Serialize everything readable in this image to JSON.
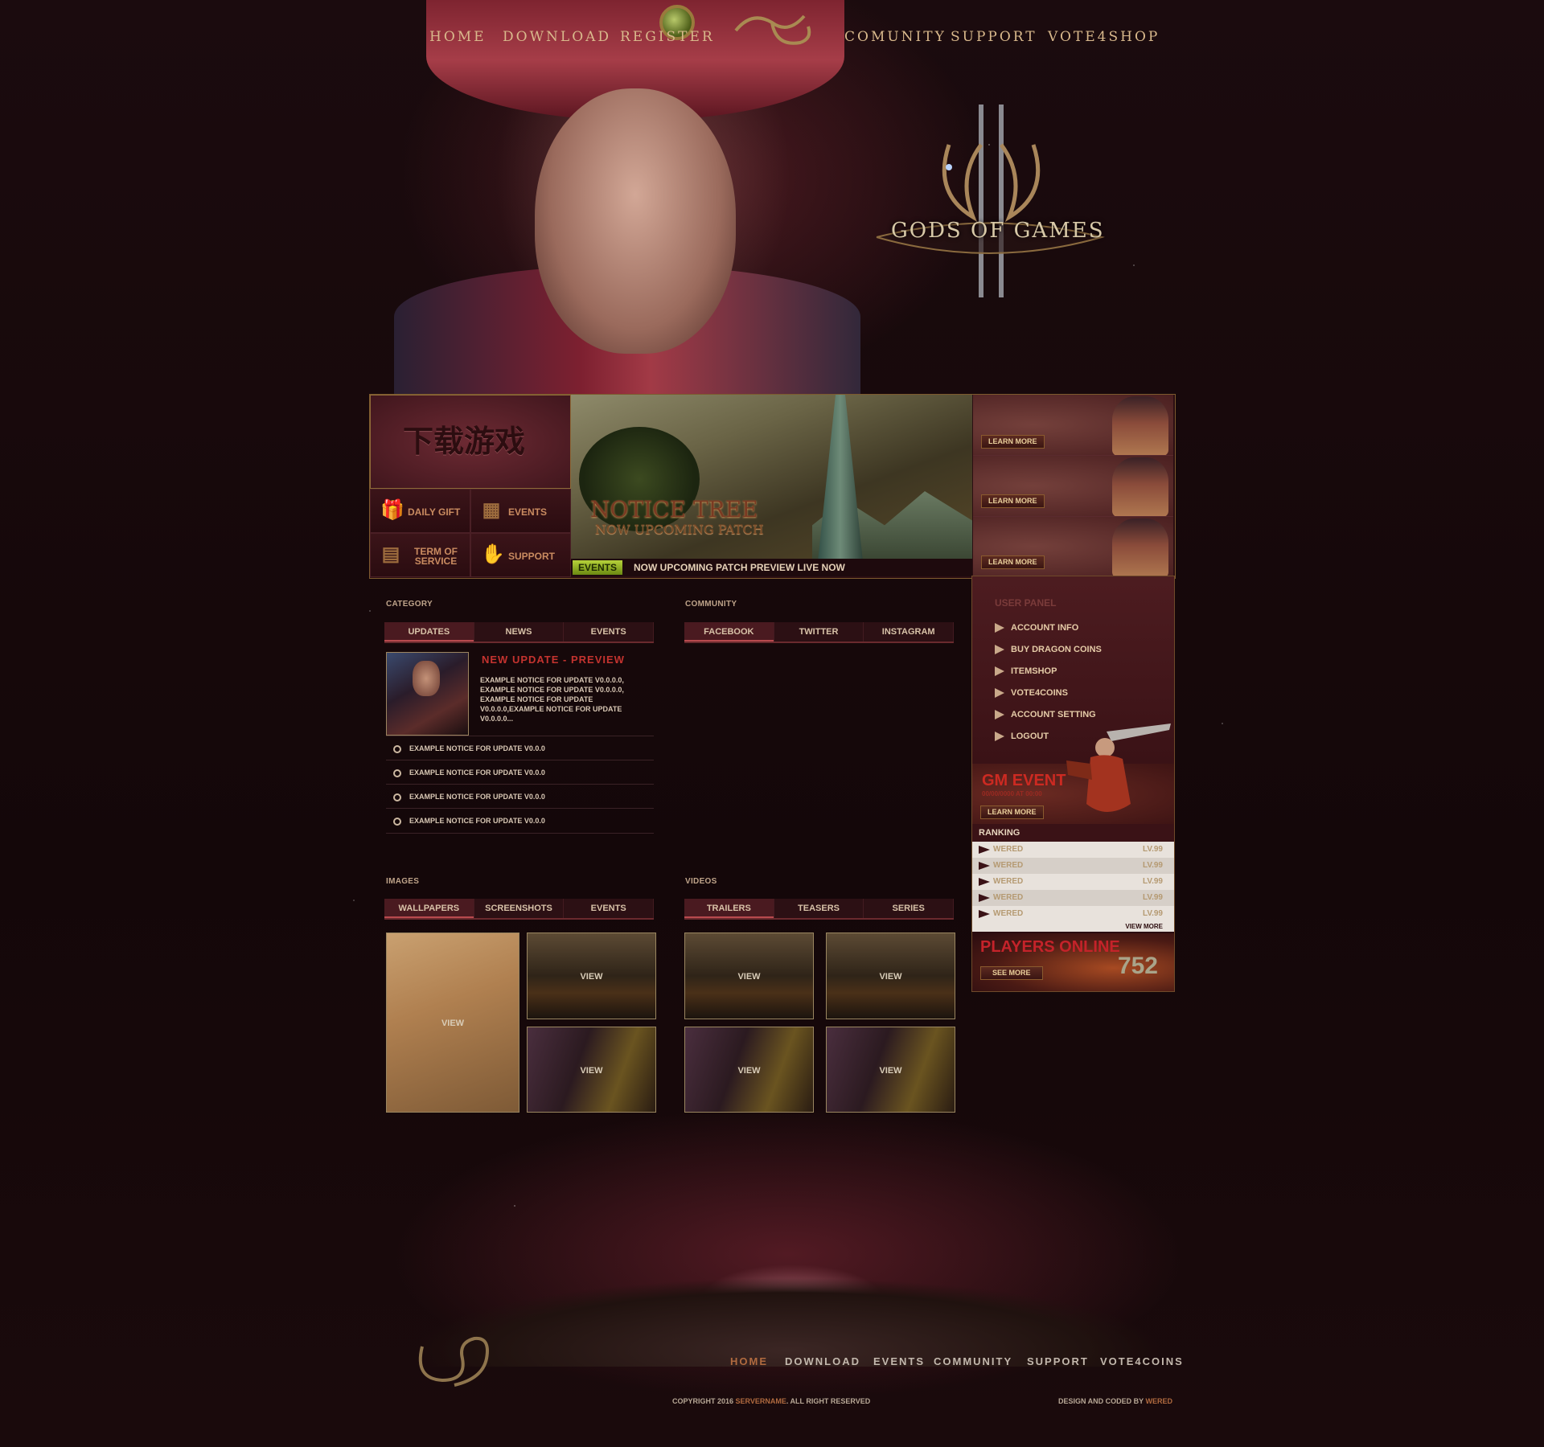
{
  "colors": {
    "accent": "#d9b98c",
    "panel": "#2a0c10",
    "highlight": "#c4332f",
    "events_tag": "#b7d23a"
  },
  "nav": {
    "home": "HOME",
    "download": "DOWNLOAD",
    "register": "REGISTER",
    "community": "COMUNITY",
    "support": "SUPPORT",
    "vote4shop": "VOTE4SHOP"
  },
  "logo": {
    "text": "GODS OF GAMES"
  },
  "download_box": {
    "text": "下载游戏"
  },
  "quick_links": [
    {
      "label": "DAILY GIFT",
      "icon": "gift-icon"
    },
    {
      "label": "EVENTS",
      "icon": "calendar-icon"
    },
    {
      "label": "TERM OF SERVICE",
      "icon": "document-icon"
    },
    {
      "label": "SUPPORT",
      "icon": "support-hand-icon"
    }
  ],
  "slider": {
    "title": "NOTICE TREE",
    "subtitle": "NOW UPCOMING PATCH"
  },
  "ticker": {
    "tag": "EVENTS",
    "message": "NOW UPCOMING PATCH PREVIEW LIVE NOW"
  },
  "promos": [
    {
      "button": "LEARN MORE"
    },
    {
      "button": "LEARN MORE"
    },
    {
      "button": "LEARN MORE"
    }
  ],
  "category": {
    "title": "CATEGORY",
    "tabs": [
      "UPDATES",
      "NEWS",
      "EVENTS"
    ],
    "featured": {
      "headline": "NEW UPDATE - PREVIEW",
      "body": "EXAMPLE NOTICE FOR UPDATE V0.0.0.0, EXAMPLE NOTICE FOR UPDATE V0.0.0.0, EXAMPLE NOTICE FOR UPDATE V0.0.0.0,EXAMPLE NOTICE FOR UPDATE V0.0.0.0..."
    },
    "items": [
      "EXAMPLE NOTICE FOR UPDATE V0.0.0",
      "EXAMPLE NOTICE FOR UPDATE V0.0.0",
      "EXAMPLE NOTICE FOR UPDATE V0.0.0",
      "EXAMPLE NOTICE FOR UPDATE V0.0.0"
    ]
  },
  "community": {
    "title": "COMMUNITY",
    "tabs": [
      "FACEBOOK",
      "TWITTER",
      "INSTAGRAM"
    ]
  },
  "user_panel": {
    "title": "USER PANEL",
    "items": [
      "ACCOUNT INFO",
      "BUY DRAGON COINS",
      "ITEMSHOP",
      "VOTE4COINS",
      "ACCOUNT SETTING",
      "LOGOUT"
    ]
  },
  "gm_event": {
    "title": "GM EVENT",
    "date": "00/00/0000 AT 00:00",
    "button": "LEARN MORE"
  },
  "ranking": {
    "title": "RANKING",
    "rows": [
      {
        "name": "WERED",
        "level": "LV.99"
      },
      {
        "name": "WERED",
        "level": "LV.99"
      },
      {
        "name": "WERED",
        "level": "LV.99"
      },
      {
        "name": "WERED",
        "level": "LV.99"
      },
      {
        "name": "WERED",
        "level": "LV.99"
      }
    ],
    "view_more": "VIEW MORE"
  },
  "players_online": {
    "title": "PLAYERS ONLINE",
    "count": "752",
    "button": "SEE MORE"
  },
  "images": {
    "title": "IMAGES",
    "tabs": [
      "WALLPAPERS",
      "SCREENSHOTS",
      "EVENTS"
    ],
    "view_label": "VIEW"
  },
  "videos": {
    "title": "VIDEOS",
    "tabs": [
      "TRAILERS",
      "TEASERS",
      "SERIES"
    ],
    "view_label": "VIEW"
  },
  "footer": {
    "nav": [
      "HOME",
      "DOWNLOAD",
      "EVENTS",
      "COMMUNITY",
      "SUPPORT",
      "VOTE4COINS"
    ],
    "copyright_prefix": "COPYRIGHT 2016 ",
    "server_name": "SERVERNAME",
    "copyright_suffix": ". ALL RIGHT RESERVED",
    "credit_prefix": "DESIGN AND CODED BY ",
    "credit_name": "WERED"
  }
}
